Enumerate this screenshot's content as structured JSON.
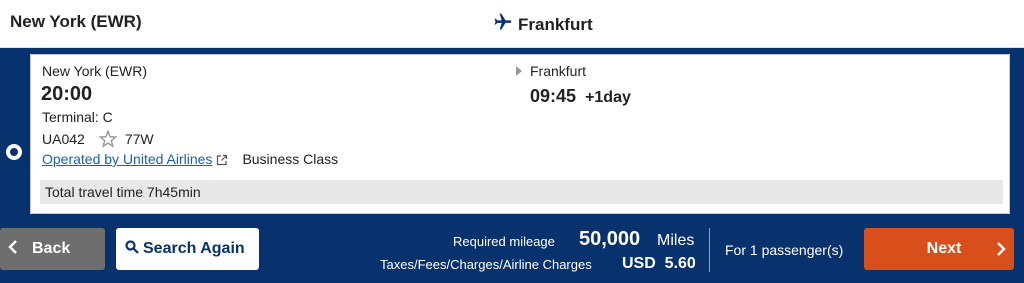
{
  "header": {
    "origin": "New York (EWR)",
    "destination": "Frankfurt"
  },
  "flight": {
    "departure": {
      "city": "New York (EWR)",
      "time": "20:00",
      "terminal": "Terminal: C"
    },
    "arrival": {
      "city": "Frankfurt",
      "time": "09:45",
      "day_offset": "+1day"
    },
    "flight_number": "UA042",
    "aircraft": "77W",
    "operated_by": "Operated by United Airlines",
    "cabin": "Business Class",
    "total_travel_time": "Total travel time 7h45min",
    "selected": true
  },
  "footer": {
    "back_label": "Back",
    "search_again_label": "Search Again",
    "mileage_label": "Required mileage",
    "mileage_value": "50,000",
    "mileage_unit": "Miles",
    "tax_label": "Taxes/Fees/Charges/Airline Charges",
    "tax_value": "USD  5.60",
    "passengers": "For 1 passenger(s)",
    "next_label": "Next"
  },
  "colors": {
    "navy": "#07326e",
    "next_button": "#d94f1b",
    "back_button": "#6e6e6e",
    "link": "#1a5fb4"
  },
  "icons": [
    "plane-icon",
    "star-alliance-icon",
    "external-link-icon",
    "chevron-left-icon",
    "search-icon",
    "chevron-right-icon",
    "arrow-right-icon"
  ]
}
